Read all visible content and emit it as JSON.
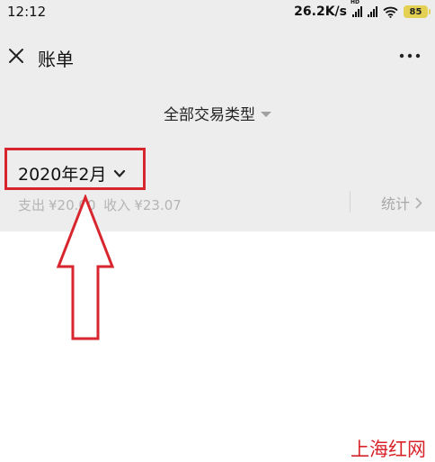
{
  "status_bar": {
    "time": "12:12",
    "net_speed": "26.2K/s",
    "hd_tag": "HD",
    "battery_level": "85"
  },
  "header": {
    "title": "账单",
    "close_icon": "close-icon",
    "more_icon": "more-icon"
  },
  "filter": {
    "label": "全部交易类型",
    "caret_icon": "caret-down-icon"
  },
  "month_section": {
    "month_label": "2020年2月",
    "expense_label": "支出",
    "expense_value": "¥20.00",
    "income_label": "收入",
    "income_value": "¥23.07",
    "stats_label": "统计"
  },
  "annotation": {
    "highlight_color": "#d8262e",
    "arrow_direction": "up"
  },
  "watermark": {
    "text": "上海红网",
    "color": "#d9232a"
  }
}
